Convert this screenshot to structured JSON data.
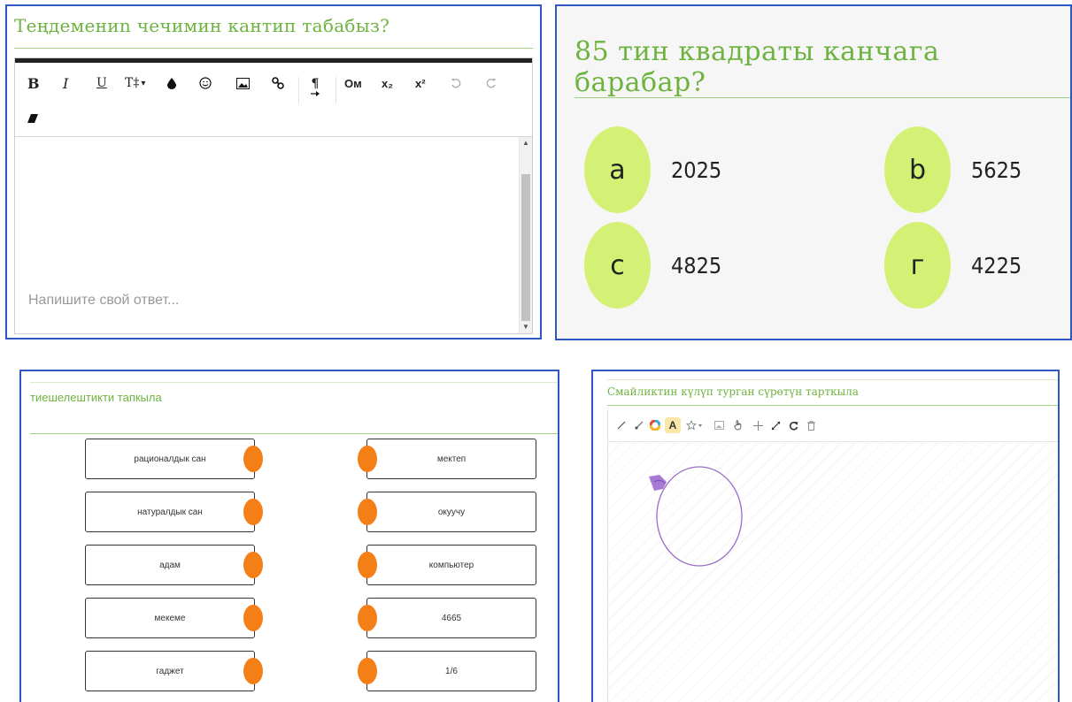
{
  "text_question": {
    "title": "Теңдемениn чечимин кантип табабыз?",
    "placeholder": "Напишите свой ответ...",
    "toolbar": {
      "bold": "B",
      "italic": "I",
      "underline": "U",
      "font_size": "T‡",
      "dropdown_caret": "▾",
      "omega": "Ом",
      "subscript": "x₂",
      "superscript": "x²",
      "paragraph": "¶"
    }
  },
  "choice_question": {
    "title": "85 тин квадраты канчага барабар?",
    "options": [
      {
        "letter": "a",
        "value": "2025"
      },
      {
        "letter": "b",
        "value": "5625"
      },
      {
        "letter": "c",
        "value": "4825"
      },
      {
        "letter": "г",
        "value": "4225"
      }
    ]
  },
  "matching_question": {
    "title": "тиешелештикти тапкыла",
    "left_items": [
      "рационалдык сан",
      "натуралдык сан",
      "адам",
      "мекеме",
      "гаджет"
    ],
    "right_items": [
      "мектеп",
      "окуучу",
      "компьютер",
      "4665",
      "1/6"
    ]
  },
  "drawing_question": {
    "title": "Смайликтин күлүп турган сүрөтүн тарткыла",
    "toolbar_icons": [
      "pencil-icon",
      "brush-icon",
      "color-wheel-icon",
      "text-icon",
      "star-icon",
      "image-icon",
      "hand-icon",
      "move-icon",
      "resize-icon",
      "redo-icon",
      "trash-icon"
    ],
    "text_tool_label": "A"
  },
  "colors": {
    "title_green": "#6db33f",
    "bubble": "#d4f176",
    "dot": "#f57f17",
    "border": "#2e57c5",
    "stroke": "#9b6cc9"
  }
}
